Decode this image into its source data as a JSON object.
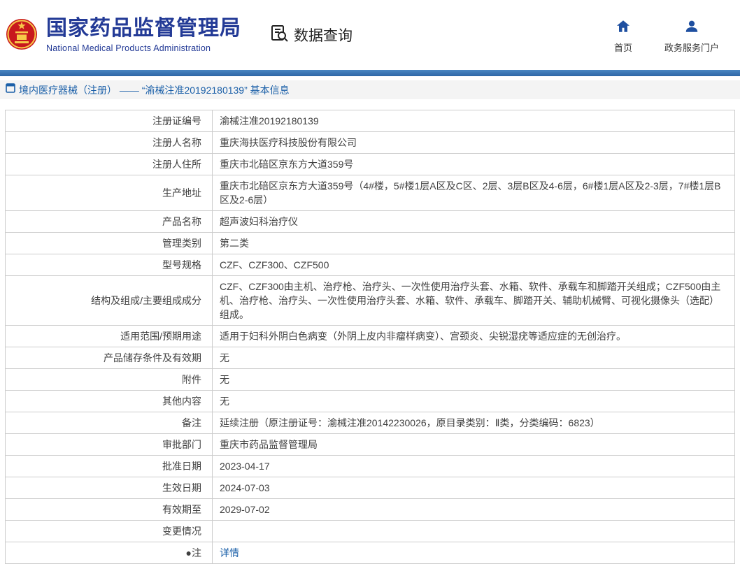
{
  "header": {
    "org_name_cn": "国家药品监督管理局",
    "org_name_en": "National Medical Products Administration",
    "nav_data_query": "数据查询",
    "nav_home": "首页",
    "nav_portal": "政务服务门户"
  },
  "breadcrumb": {
    "text": "境内医疗器械（注册） —— “渝械注准20192180139” 基本信息"
  },
  "table": {
    "rows": [
      {
        "label": "注册证编号",
        "value": "渝械注准20192180139"
      },
      {
        "label": "注册人名称",
        "value": "重庆海扶医疗科技股份有限公司"
      },
      {
        "label": "注册人住所",
        "value": "重庆市北碚区京东方大道359号"
      },
      {
        "label": "生产地址",
        "value": "重庆市北碚区京东方大道359号（4#楼，5#楼1层A区及C区、2层、3层B区及4-6层，6#楼1层A区及2-3层，7#楼1层B区及2-6层）"
      },
      {
        "label": "产品名称",
        "value": "超声波妇科治疗仪"
      },
      {
        "label": "管理类别",
        "value": "第二类"
      },
      {
        "label": "型号规格",
        "value": "CZF、CZF300、CZF500"
      },
      {
        "label": "结构及组成/主要组成成分",
        "value": "CZF、CZF300由主机、治疗枪、治疗头、一次性使用治疗头套、水箱、软件、承载车和脚踏开关组成；CZF500由主机、治疗枪、治疗头、一次性使用治疗头套、水箱、软件、承载车、脚踏开关、辅助机械臂、可视化摄像头（选配）组成。"
      },
      {
        "label": "适用范围/预期用途",
        "value": "适用于妇科外阴白色病变（外阴上皮内非瘤样病变）、宫颈炎、尖锐湿疣等适应症的无创治疗。"
      },
      {
        "label": "产品储存条件及有效期",
        "value": "无"
      },
      {
        "label": "附件",
        "value": "无"
      },
      {
        "label": "其他内容",
        "value": "无"
      },
      {
        "label": "备注",
        "value": "延续注册（原注册证号：渝械注准20142230026，原目录类别：Ⅱ类，分类编码：6823）"
      },
      {
        "label": "审批部门",
        "value": "重庆市药品监督管理局"
      },
      {
        "label": "批准日期",
        "value": "2023-04-17"
      },
      {
        "label": "生效日期",
        "value": "2024-07-03"
      },
      {
        "label": "有效期至",
        "value": "2029-07-02"
      },
      {
        "label": "变更情况",
        "value": ""
      },
      {
        "label": "●注",
        "value": "详情",
        "link": true
      }
    ]
  },
  "colors": {
    "title_blue": "#233a96",
    "bar_blue": "#2e66a6",
    "link_blue": "#1a5fa8",
    "emblem_red": "#c8181d",
    "emblem_gold": "#f7c948",
    "border_gray": "#cccccc"
  }
}
